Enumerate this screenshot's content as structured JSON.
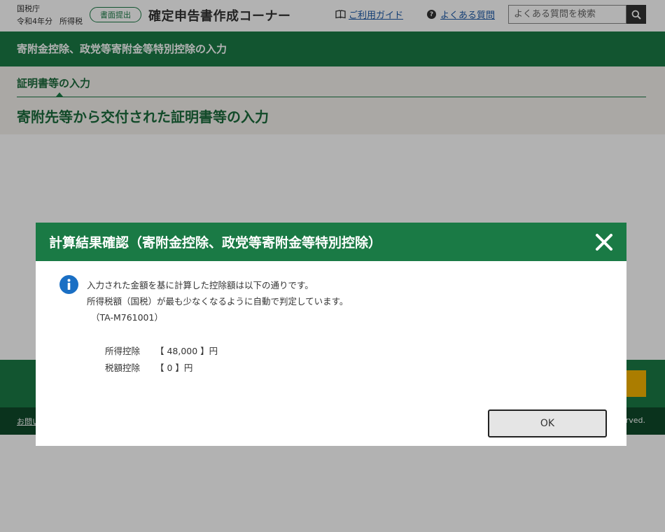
{
  "header": {
    "agency": "国税庁",
    "year": "令和4年分",
    "tax_type": "所得税",
    "mode_badge": "書面提出",
    "app_title": "確定申告書作成コーナー",
    "guide_link": "ご利用ガイド",
    "faq_link": "よくある質問",
    "search_placeholder": "よくある質問を検索"
  },
  "section": {
    "title": "寄附金控除、政党等寄附金等特別控除の入力"
  },
  "step": {
    "label": "証明書等の入力",
    "heading": "寄附先等から交付された証明書等の入力"
  },
  "footer": {
    "link_visible": "お問い",
    "copyright_visible": "rved."
  },
  "modal": {
    "title": "計算結果確認（寄附金控除、政党等寄附金等特別控除）",
    "message_line1": "入力された金額を基に計算した控除額は以下の通りです。",
    "message_line2": "所得税額（国税）が最も少なくなるように自動で判定しています。",
    "message_code": "（TA-M761001）",
    "results": [
      {
        "label": "所得控除",
        "value": "【 48,000 】円"
      },
      {
        "label": "税額控除",
        "value": "【 0 】円"
      }
    ],
    "ok_label": "OK"
  },
  "colors": {
    "primary_green": "#1a7a45",
    "dark_green": "#0f4a2a",
    "accent_yellow": "#f5b400",
    "info_blue": "#1a6fc4",
    "link_blue": "#1d5aa8"
  }
}
